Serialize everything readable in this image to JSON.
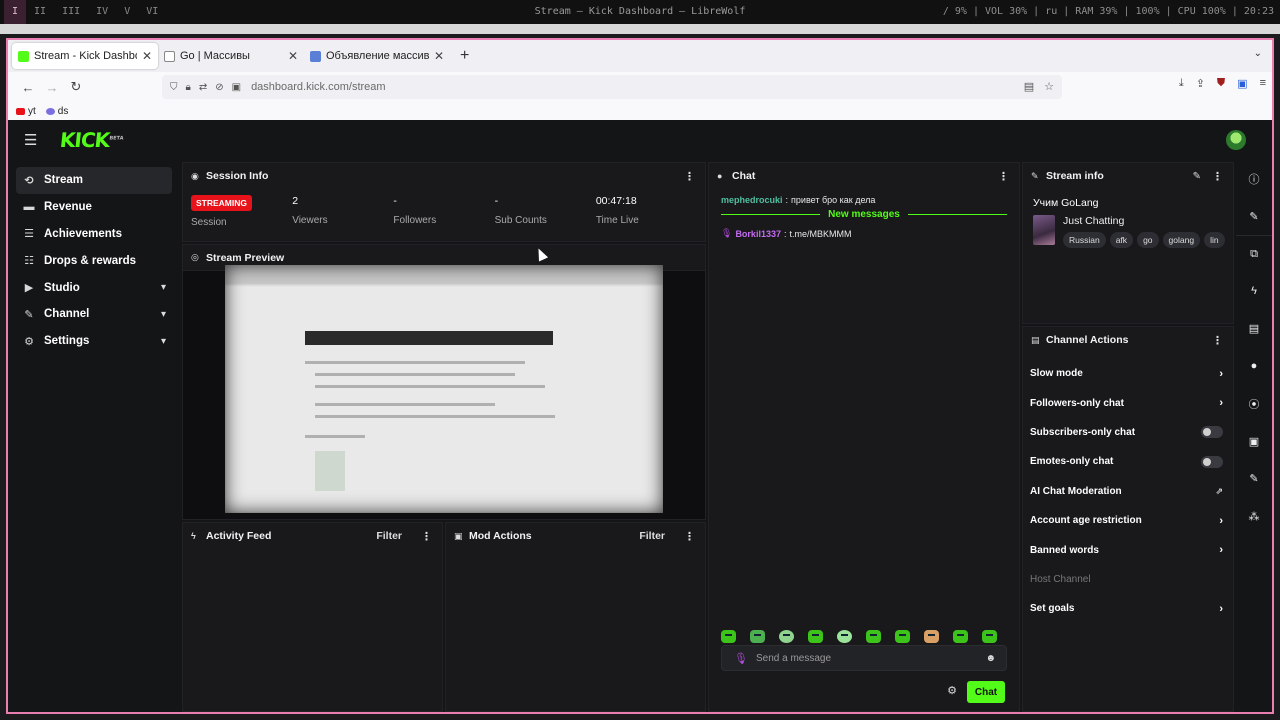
{
  "system": {
    "workspaces": [
      "I",
      "II",
      "III",
      "IV",
      "V",
      "VI"
    ],
    "window_title": "Stream — Kick Dashboard — LibreWolf",
    "status_line": "/ 9% | VOL 30% | ru | RAM 39% | 100% | CPU 100% | 20:23"
  },
  "browser": {
    "tabs": [
      {
        "label": "Stream - Kick Dashboar",
        "color": "#53fc18"
      },
      {
        "label": "Go | Массивы",
        "color": "#3a6ea5"
      },
      {
        "label": "Объявление массива с",
        "color": "#5b7fd6"
      }
    ],
    "url": "dashboard.kick.com/stream",
    "bookmarks": [
      {
        "label": "yt",
        "color": "#e8121a"
      },
      {
        "label": "ds",
        "color": "#7b6fe0"
      }
    ]
  },
  "sidebar": {
    "items": [
      {
        "label": "Stream",
        "icon": "broadcast-icon"
      },
      {
        "label": "Revenue",
        "icon": "revenue-icon"
      },
      {
        "label": "Achievements",
        "icon": "achievements-icon"
      },
      {
        "label": "Drops & rewards",
        "icon": "drops-icon"
      },
      {
        "label": "Studio",
        "icon": "studio-icon"
      },
      {
        "label": "Channel",
        "icon": "channel-icon"
      },
      {
        "label": "Settings",
        "icon": "settings-icon"
      }
    ]
  },
  "session": {
    "title": "Session Info",
    "status": "STREAMING",
    "status_label": "Session",
    "viewers": "2",
    "viewers_label": "Viewers",
    "followers": "-",
    "followers_label": "Followers",
    "subs": "-",
    "subs_label": "Sub Counts",
    "time_live": "00:47:18",
    "time_label": "Time Live"
  },
  "preview": {
    "title": "Stream Preview"
  },
  "activity": {
    "title": "Activity Feed",
    "filter": "Filter"
  },
  "mod": {
    "title": "Mod Actions",
    "filter": "Filter"
  },
  "chat": {
    "title": "Chat",
    "messages": [
      {
        "user": "mephedrocuki",
        "text": "привет бро как дела",
        "color": "#4fbf9f"
      },
      {
        "user": "Borkil1337",
        "text": "t.me/MBKMMM",
        "color": "#c46cf0"
      }
    ],
    "new_messages": "New messages",
    "placeholder": "Send a message",
    "send": "Chat"
  },
  "stream_info": {
    "title": "Stream info",
    "stream_title": "Учим GoLang",
    "category": "Just Chatting",
    "tags": [
      "Russian",
      "afk",
      "go",
      "golang",
      "lin"
    ]
  },
  "actions": {
    "title": "Channel Actions",
    "items": [
      {
        "label": "Slow mode",
        "control": "arrow"
      },
      {
        "label": "Followers-only chat",
        "control": "arrow"
      },
      {
        "label": "Subscribers-only chat",
        "control": "toggle"
      },
      {
        "label": "Emotes-only chat",
        "control": "toggle"
      },
      {
        "label": "AI Chat Moderation",
        "control": "external"
      },
      {
        "label": "Account age restriction",
        "control": "arrow"
      },
      {
        "label": "Banned words",
        "control": "arrow"
      },
      {
        "label": "Host Channel",
        "control": "none"
      },
      {
        "label": "Set goals",
        "control": "arrow"
      }
    ]
  },
  "colors": {
    "accent": "#53fc18",
    "live": "#e8121a"
  }
}
